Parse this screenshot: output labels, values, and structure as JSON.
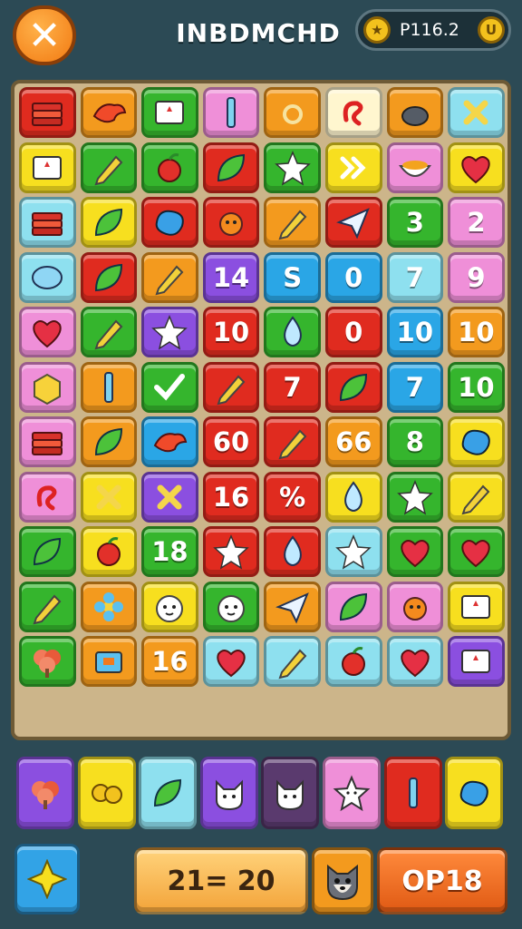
{
  "header": {
    "title": "INBDMCHD",
    "close_label": "✕",
    "score_text": "P116.2",
    "star_coin": "★",
    "u_coin": "U"
  },
  "colors": {
    "bg": "#2c4a55",
    "red": "#e02b1f",
    "orange": "#f39a1e",
    "green": "#35b52d",
    "blue": "#2aa6e6",
    "yellow": "#f7df1f",
    "purple": "#8b4fe0",
    "pink": "#ef8fd8",
    "cyan": "#8ee0ef"
  },
  "board": {
    "rows": [
      [
        {
          "c": "red",
          "t": "book"
        },
        {
          "c": "orange",
          "t": "bird"
        },
        {
          "c": "green",
          "t": "card"
        },
        {
          "c": "pink",
          "t": "stick"
        },
        {
          "c": "orange",
          "t": "ring"
        },
        {
          "c": "cream",
          "t": "swirl"
        },
        {
          "c": "orange",
          "t": "pot"
        },
        {
          "c": "cyan",
          "t": "cross"
        }
      ],
      [
        {
          "c": "yellow",
          "t": "card"
        },
        {
          "c": "green",
          "t": "pencil"
        },
        {
          "c": "green",
          "t": "apple"
        },
        {
          "c": "red",
          "t": "leaf"
        },
        {
          "c": "green",
          "t": "star"
        },
        {
          "c": "yellow",
          "t": "arrow"
        },
        {
          "c": "pink",
          "t": "bowl"
        },
        {
          "c": "yellow",
          "t": "heart"
        }
      ],
      [
        {
          "c": "cyan",
          "t": "book"
        },
        {
          "c": "yellow",
          "t": "leaf"
        },
        {
          "c": "red",
          "t": "blob"
        },
        {
          "c": "red",
          "t": "fruit"
        },
        {
          "c": "orange",
          "t": "pencil"
        },
        {
          "c": "red",
          "t": "plane"
        },
        {
          "c": "green",
          "n": "3"
        },
        {
          "c": "pink",
          "n": "2"
        }
      ],
      [
        {
          "c": "cyan",
          "t": "gem"
        },
        {
          "c": "red",
          "t": "leaf"
        },
        {
          "c": "orange",
          "t": "pencil"
        },
        {
          "c": "purple",
          "n": "14"
        },
        {
          "c": "blue",
          "n": "S"
        },
        {
          "c": "blue",
          "n": "0"
        },
        {
          "c": "cyan",
          "n": "7"
        },
        {
          "c": "pink",
          "n": "9"
        }
      ],
      [
        {
          "c": "pink",
          "t": "heart"
        },
        {
          "c": "green",
          "t": "pencil"
        },
        {
          "c": "purple",
          "t": "star"
        },
        {
          "c": "red",
          "n": "10"
        },
        {
          "c": "green",
          "t": "drop"
        },
        {
          "c": "red",
          "n": "0"
        },
        {
          "c": "blue",
          "n": "10"
        },
        {
          "c": "orange",
          "n": "10"
        }
      ],
      [
        {
          "c": "pink",
          "t": "box"
        },
        {
          "c": "orange",
          "t": "stick"
        },
        {
          "c": "green",
          "t": "check"
        },
        {
          "c": "red",
          "t": "pencil"
        },
        {
          "c": "red",
          "n": "7"
        },
        {
          "c": "red",
          "t": "leaf"
        },
        {
          "c": "blue",
          "n": "7"
        },
        {
          "c": "green",
          "n": "10"
        }
      ],
      [
        {
          "c": "pink",
          "t": "book"
        },
        {
          "c": "orange",
          "t": "leaf"
        },
        {
          "c": "blue",
          "t": "bird"
        },
        {
          "c": "red",
          "n": "60"
        },
        {
          "c": "red",
          "t": "pencil"
        },
        {
          "c": "orange",
          "n": "66"
        },
        {
          "c": "green",
          "n": "8"
        },
        {
          "c": "yellow",
          "t": "blob"
        }
      ],
      [
        {
          "c": "pink",
          "t": "swirl"
        },
        {
          "c": "yellow",
          "t": "cross"
        },
        {
          "c": "purple",
          "t": "cross"
        },
        {
          "c": "red",
          "n": "16"
        },
        {
          "c": "red",
          "n": "%"
        },
        {
          "c": "yellow",
          "t": "drop"
        },
        {
          "c": "green",
          "t": "star"
        },
        {
          "c": "yellow",
          "t": "pencil"
        }
      ],
      [
        {
          "c": "green",
          "t": "leaf"
        },
        {
          "c": "yellow",
          "t": "apple"
        },
        {
          "c": "green",
          "n": "18"
        },
        {
          "c": "red",
          "t": "star"
        },
        {
          "c": "red",
          "t": "drop"
        },
        {
          "c": "cyan",
          "t": "star"
        },
        {
          "c": "green",
          "t": "heart"
        },
        {
          "c": "green",
          "t": "heart"
        }
      ],
      [
        {
          "c": "green",
          "t": "pencil"
        },
        {
          "c": "orange",
          "t": "flower"
        },
        {
          "c": "yellow",
          "t": "face"
        },
        {
          "c": "green",
          "t": "face"
        },
        {
          "c": "orange",
          "t": "plane"
        },
        {
          "c": "pink",
          "t": "leaf"
        },
        {
          "c": "pink",
          "t": "fruit"
        },
        {
          "c": "yellow",
          "t": "card"
        }
      ],
      [
        {
          "c": "green",
          "t": "tree"
        },
        {
          "c": "orange",
          "t": "tv"
        },
        {
          "c": "orange",
          "n": "16"
        },
        {
          "c": "cyan",
          "t": "heart"
        },
        {
          "c": "cyan",
          "t": "pencil"
        },
        {
          "c": "cyan",
          "t": "apple"
        },
        {
          "c": "cyan",
          "t": "heart"
        },
        {
          "c": "purple",
          "t": "card"
        }
      ]
    ]
  },
  "tray": [
    {
      "c": "purple",
      "t": "tree"
    },
    {
      "c": "yellow",
      "t": "coins"
    },
    {
      "c": "cyan",
      "t": "leaf"
    },
    {
      "c": "purple",
      "t": "cat"
    },
    {
      "c": "darkpurple",
      "t": "cat"
    },
    {
      "c": "pink",
      "t": "staricon"
    },
    {
      "c": "red",
      "t": "stick"
    },
    {
      "c": "yellow",
      "t": "blob"
    }
  ],
  "footer": {
    "shuffle_label": "✕",
    "progress_text": "21= 20",
    "action_label": "OP18"
  }
}
